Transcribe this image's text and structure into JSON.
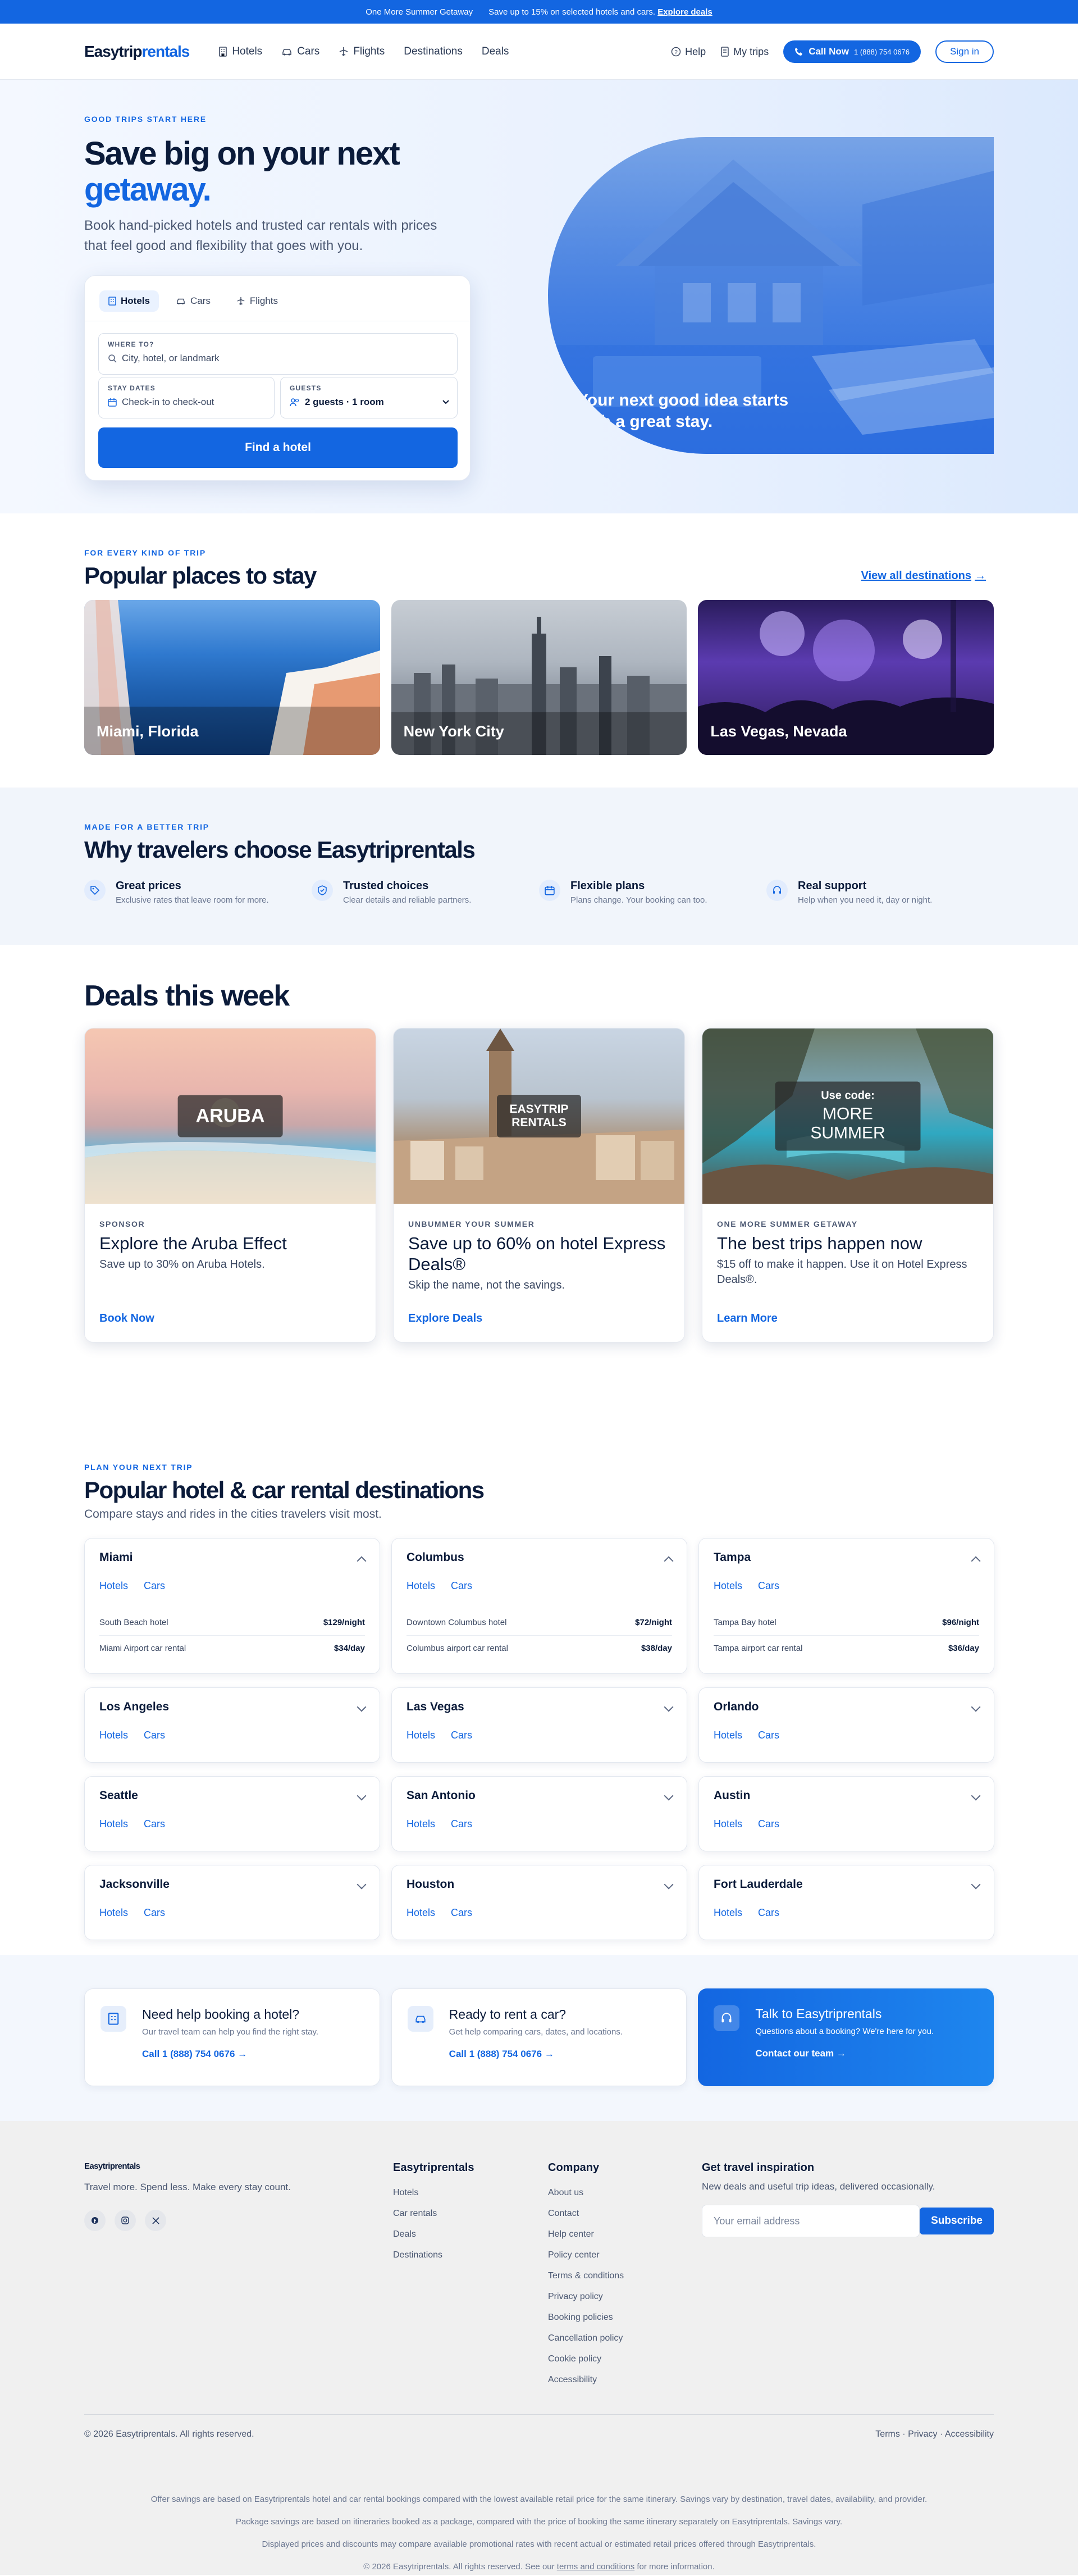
{
  "promo": {
    "title": "One More Summer Getaway",
    "text": "Save up to 15% on selected hotels and cars.",
    "link": "Explore deals"
  },
  "nav": {
    "logo_a": "Easytrip",
    "logo_b": "rentals",
    "links": [
      {
        "label": "Hotels",
        "icon": "building-icon"
      },
      {
        "label": "Cars",
        "icon": "car-icon"
      },
      {
        "label": "Flights",
        "icon": "plane-icon"
      },
      {
        "label": "Destinations"
      },
      {
        "label": "Deals"
      }
    ],
    "help": "Help",
    "trips": "My trips",
    "call_label": "Call Now",
    "call_number": "1 (888) 754 0676",
    "signin": "Sign in"
  },
  "hero": {
    "eyebrow": "GOOD TRIPS START HERE",
    "title_a": "Save big on your next",
    "title_b": "getaway.",
    "subtitle": "Book hand-picked hotels and trusted car rentals with prices that feel good and flexibility that goes with you.",
    "image_caption": "Your next good idea starts with a great stay."
  },
  "search": {
    "tabs": [
      "Hotels",
      "Cars",
      "Flights"
    ],
    "where_label": "WHERE TO?",
    "where_placeholder": "City, hotel, or landmark",
    "dates_label": "STAY DATES",
    "dates_value": "Check-in to check-out",
    "guests_label": "GUESTS",
    "guests_value": "2 guests · 1 room",
    "button": "Find a hotel"
  },
  "popular": {
    "eyebrow": "FOR EVERY KIND OF TRIP",
    "title": "Popular places to stay",
    "view_all": "View all destinations",
    "cities": [
      "Miami, Florida",
      "New York City",
      "Las Vegas, Nevada"
    ]
  },
  "why": {
    "eyebrow": "MADE FOR A BETTER TRIP",
    "title": "Why travelers choose Easytriprentals",
    "features": [
      {
        "title": "Great prices",
        "desc": "Exclusive rates that leave room for more.",
        "icon": "tag-icon"
      },
      {
        "title": "Trusted choices",
        "desc": "Clear details and reliable partners.",
        "icon": "shield-icon"
      },
      {
        "title": "Flexible plans",
        "desc": "Plans change. Your booking can too.",
        "icon": "calendar-icon"
      },
      {
        "title": "Real support",
        "desc": "Help when you need it, day or night.",
        "icon": "headset-icon"
      }
    ]
  },
  "deals": {
    "title": "Deals this week",
    "cards": [
      {
        "badge": "ARUBA",
        "badge_small": "",
        "eyebrow": "SPONSOR",
        "title": "Explore the Aruba Effect",
        "desc": "Save up to 30% on Aruba Hotels.",
        "link": "Book Now"
      },
      {
        "badge": "EASYTRIP RENTALS",
        "badge_small": "",
        "eyebrow": "UNBUMMER YOUR SUMMER",
        "title": "Save up to 60% on hotel Express Deals®",
        "desc": "Skip the name, not the savings.",
        "link": "Explore Deals"
      },
      {
        "badge": "MORE SUMMER",
        "badge_small": "Use code:",
        "eyebrow": "ONE MORE SUMMER GETAWAY",
        "title": "The best trips happen now",
        "desc": "$15 off to make it happen. Use it on Hotel Express Deals®.",
        "link": "Learn More"
      }
    ]
  },
  "destinations": {
    "eyebrow": "PLAN YOUR NEXT TRIP",
    "title": "Popular hotel & car rental destinations",
    "subtitle": "Compare stays and rides in the cities travelers visit most.",
    "hotels_label": "Hotels",
    "cars_label": "Cars",
    "cities": [
      {
        "name": "Miami",
        "open": true,
        "rows": [
          {
            "label": "South Beach hotel",
            "price": "$129/night"
          },
          {
            "label": "Miami Airport car rental",
            "price": "$34/day"
          }
        ]
      },
      {
        "name": "Columbus",
        "open": true,
        "rows": [
          {
            "label": "Downtown Columbus hotel",
            "price": "$72/night"
          },
          {
            "label": "Columbus airport car rental",
            "price": "$38/day"
          }
        ]
      },
      {
        "name": "Tampa",
        "open": true,
        "rows": [
          {
            "label": "Tampa Bay hotel",
            "price": "$96/night"
          },
          {
            "label": "Tampa airport car rental",
            "price": "$36/day"
          }
        ]
      },
      {
        "name": "Los Angeles",
        "open": false
      },
      {
        "name": "Las Vegas",
        "open": false
      },
      {
        "name": "Orlando",
        "open": false
      },
      {
        "name": "Seattle",
        "open": false
      },
      {
        "name": "San Antonio",
        "open": false
      },
      {
        "name": "Austin",
        "open": false
      },
      {
        "name": "Jacksonville",
        "open": false
      },
      {
        "name": "Houston",
        "open": false
      },
      {
        "name": "Fort Lauderdale",
        "open": false
      }
    ]
  },
  "help": [
    {
      "title": "Need help booking a hotel?",
      "desc": "Our travel team can help you find the right stay.",
      "link": "Call 1 (888) 754 0676",
      "icon": "hotel-icon"
    },
    {
      "title": "Ready to rent a car?",
      "desc": "Get help comparing cars, dates, and locations.",
      "link": "Call 1 (888) 754 0676",
      "icon": "car-icon"
    },
    {
      "title": "Talk to Easytriprentals",
      "desc": "Questions about a booking? We're here for you.",
      "link": "Contact our team",
      "icon": "headset-icon"
    }
  ],
  "footer": {
    "logo": "Easytriprentals",
    "tagline": "Travel more. Spend less. Make every stay count.",
    "col1_title": "Easytriprentals",
    "col1": [
      "Hotels",
      "Car rentals",
      "Deals",
      "Destinations"
    ],
    "col2_title": "Company",
    "col2": [
      "About us",
      "Contact",
      "Help center",
      "Policy center",
      "Terms & conditions",
      "Privacy policy",
      "Booking policies",
      "Cancellation policy",
      "Cookie policy",
      "Accessibility"
    ],
    "news_title": "Get travel inspiration",
    "news_desc": "New deals and useful trip ideas, delivered occasionally.",
    "news_placeholder": "Your email address",
    "news_button": "Subscribe",
    "copyright": "© 2026 Easytriprentals. All rights reserved.",
    "bottom_links": "Terms · Privacy · Accessibility",
    "legal1": "Offer savings are based on Easytriprentals hotel and car rental bookings compared with the lowest available retail price for the same itinerary. Savings vary by destination, travel dates, availability, and provider.",
    "legal2": "Package savings are based on itineraries booked as a package, compared with the price of booking the same itinerary separately on Easytriprentals. Savings vary.",
    "legal3": "Displayed prices and discounts may compare available promotional rates with recent actual or estimated retail prices offered through Easytriprentals.",
    "legal4_a": "© 2026 Easytriprentals. All rights reserved. See our",
    "legal4_link": "terms and conditions",
    "legal4_b": "for more information."
  }
}
